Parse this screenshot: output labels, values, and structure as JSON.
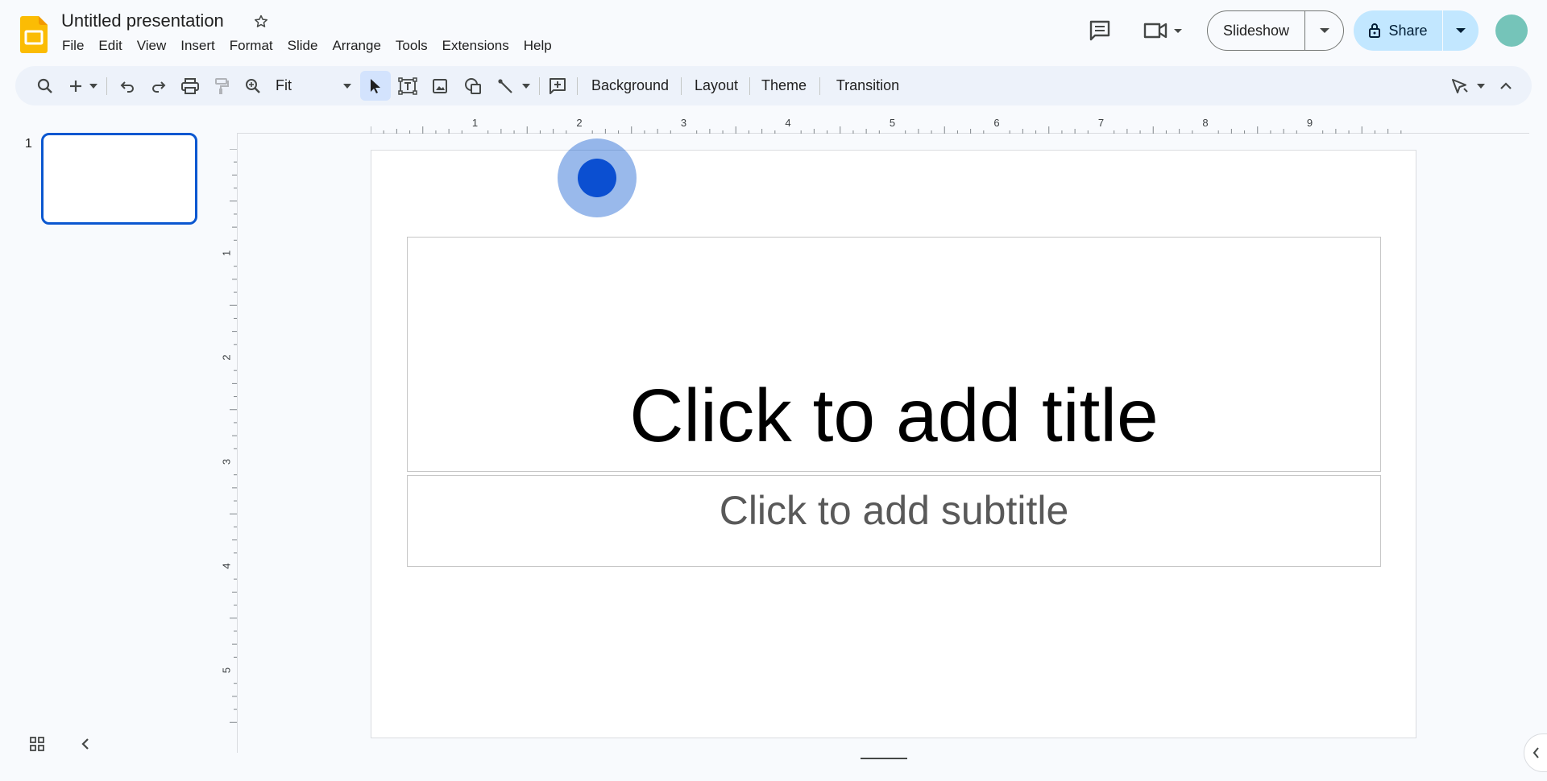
{
  "header": {
    "doc_title": "Untitled presentation",
    "menu": [
      "File",
      "Edit",
      "View",
      "Insert",
      "Format",
      "Slide",
      "Arrange",
      "Tools",
      "Extensions",
      "Help"
    ],
    "slideshow_label": "Slideshow",
    "share_label": "Share",
    "icons": [
      "slides-logo-icon",
      "star-icon",
      "comments-icon",
      "meet-video-icon",
      "lock-icon",
      "avatar"
    ]
  },
  "toolbar": {
    "zoom_value": "Fit",
    "background_label": "Background",
    "layout_label": "Layout",
    "theme_label": "Theme",
    "transition_label": "Transition"
  },
  "filmstrip": {
    "slides": [
      {
        "number": "1"
      }
    ]
  },
  "ruler": {
    "h_labels": [
      "1",
      "2",
      "3",
      "4",
      "5",
      "6",
      "7",
      "8",
      "9"
    ],
    "v_labels": [
      "1",
      "2",
      "3",
      "4",
      "5"
    ]
  },
  "slide": {
    "title_placeholder": "Click to add title",
    "subtitle_placeholder": "Click to add subtitle"
  },
  "colors": {
    "accent": "#0b57d0",
    "share_bg": "#c2e7ff",
    "toolbar_bg": "#edf2fa",
    "page_bg": "#f8fafd",
    "logo_yellow": "#fbbc04",
    "avatar": "#75c4b9"
  }
}
